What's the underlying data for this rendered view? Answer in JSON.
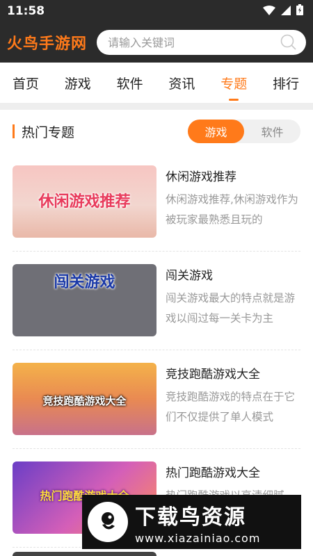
{
  "status_bar": {
    "time": "11:58"
  },
  "header": {
    "logo": "火鸟手游网",
    "search_placeholder": "请输入关键词"
  },
  "nav": {
    "tabs": [
      "首页",
      "游戏",
      "软件",
      "资讯",
      "专题",
      "排行"
    ],
    "active_index": 4
  },
  "section": {
    "title": "热门专题",
    "toggle": [
      "游戏",
      "软件"
    ],
    "toggle_active": 0
  },
  "topics": [
    {
      "thumb_text": "休闲游戏推荐",
      "title": "休闲游戏推荐",
      "desc": "休闲游戏推荐,休闲游戏作为被玩家最熟悉且玩的"
    },
    {
      "thumb_text": "闯关游戏",
      "title": "闯关游戏",
      "desc": "闯关游戏最大的特点就是游戏以闯过每一关卡为主"
    },
    {
      "thumb_text": "竞技跑酷游戏大全",
      "title": "竞技跑酷游戏大全",
      "desc": "竞技跑酷游戏的特点在于它们不仅提供了单人模式"
    },
    {
      "thumb_text": "热门跑酷游戏大全",
      "title": "热门跑酷游戏大全",
      "desc": "热门跑酷游戏以高清细腻"
    }
  ],
  "watermark": {
    "title": "下载鸟资源",
    "url": "www.xiazainiao.com"
  },
  "colors": {
    "accent": "#ff7a1a",
    "header_bg": "#2b2b2b"
  }
}
